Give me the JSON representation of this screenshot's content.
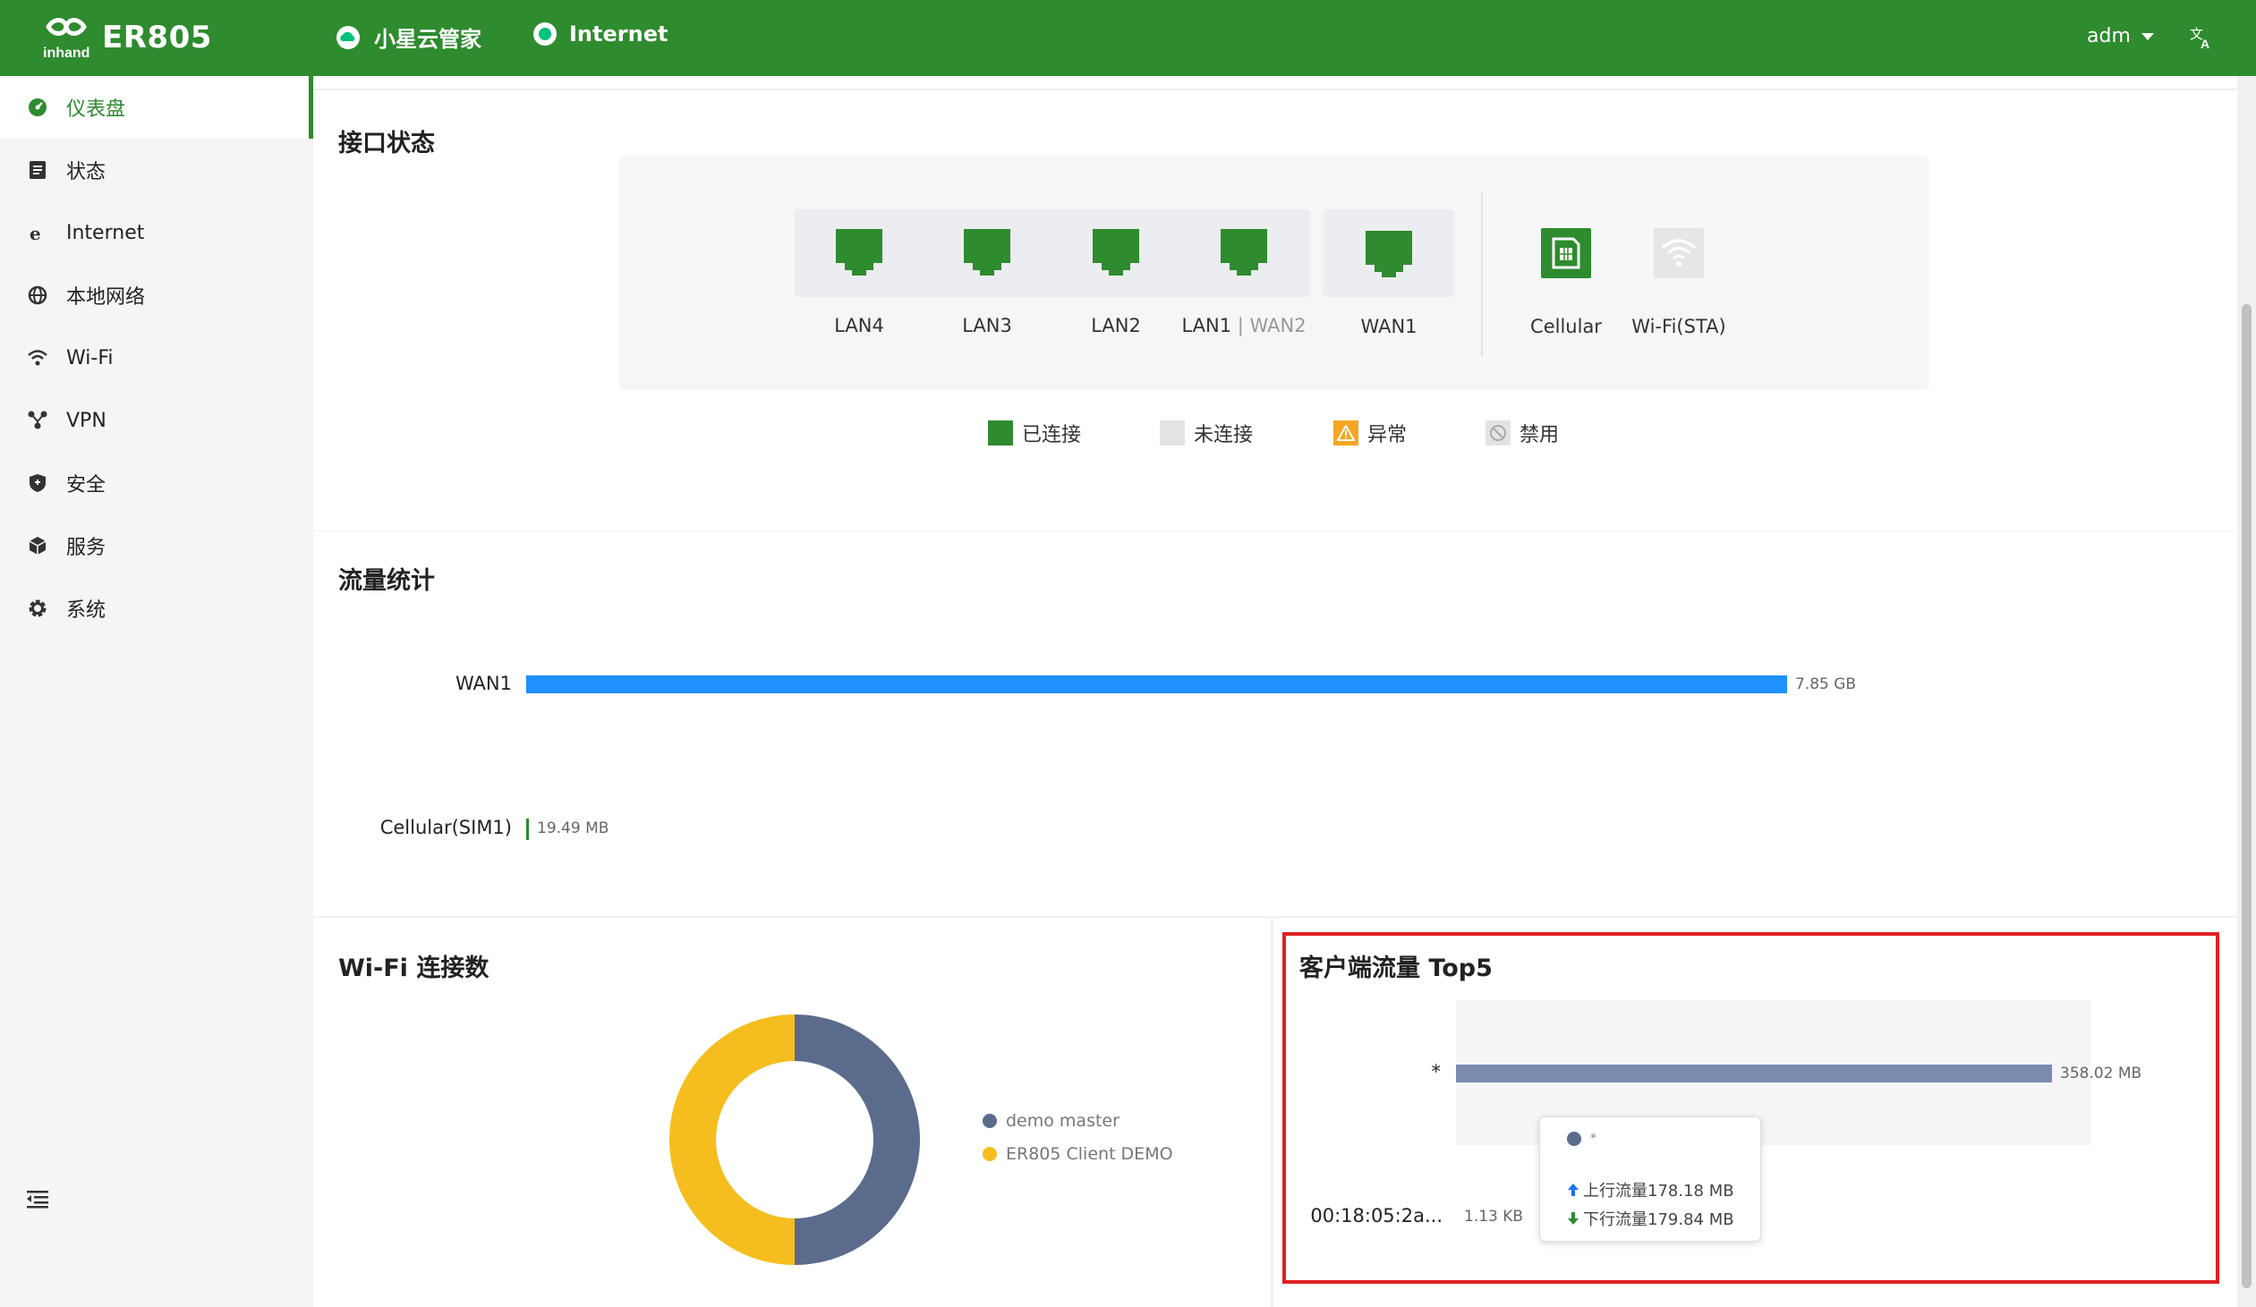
{
  "header": {
    "product": "ER805",
    "brand": "inhand",
    "cloud_label": "小星云管家",
    "internet_label": "Internet",
    "user": "adm"
  },
  "sidebar": {
    "items": [
      {
        "label": "仪表盘",
        "icon": "dashboard-icon"
      },
      {
        "label": "状态",
        "icon": "status-icon"
      },
      {
        "label": "Internet",
        "icon": "internet-icon"
      },
      {
        "label": "本地网络",
        "icon": "globe-icon"
      },
      {
        "label": "Wi-Fi",
        "icon": "wifi-icon"
      },
      {
        "label": "VPN",
        "icon": "vpn-icon"
      },
      {
        "label": "安全",
        "icon": "shield-icon"
      },
      {
        "label": "服务",
        "icon": "cube-icon"
      },
      {
        "label": "系统",
        "icon": "gear-icon"
      }
    ],
    "active": "仪表盘"
  },
  "interface_status": {
    "title": "接口状态",
    "ports": [
      {
        "label": "LAN4",
        "status": "connected"
      },
      {
        "label": "LAN3",
        "status": "connected"
      },
      {
        "label": "LAN2",
        "status": "connected"
      },
      {
        "label": "LAN1",
        "sub": "WAN2",
        "status": "connected"
      },
      {
        "label": "WAN1",
        "status": "connected"
      },
      {
        "label": "Cellular",
        "status": "connected"
      },
      {
        "label": "Wi-Fi(STA)",
        "status": "disconnected"
      }
    ],
    "legend": {
      "connected": "已连接",
      "disconnected": "未连接",
      "abnormal": "异常",
      "disabled": "禁用"
    }
  },
  "traffic": {
    "title": "流量统计",
    "rows": [
      {
        "label": "WAN1",
        "value": "7.85 GB"
      },
      {
        "label": "Cellular(SIM1)",
        "value": "19.49 MB"
      }
    ]
  },
  "wifi": {
    "title": "Wi-Fi 连接数",
    "legend": [
      {
        "name": "demo master",
        "color": "#5b6b8c"
      },
      {
        "name": "ER805 Client DEMO",
        "color": "#f5be1e"
      }
    ]
  },
  "top5": {
    "title": "客户端流量 Top5",
    "rows": [
      {
        "label": "*",
        "value": "358.02 MB"
      },
      {
        "label": "00:18:05:2a...",
        "value": "1.13 KB"
      }
    ],
    "tooltip": {
      "name": "*",
      "up": "上行流量178.18 MB",
      "down": "下行流量179.84 MB"
    }
  },
  "chart_data": [
    {
      "type": "bar",
      "categories": [
        "WAN1",
        "Cellular(SIM1)"
      ],
      "values": [
        7.85,
        0.01949
      ],
      "title": "流量统计"
    },
    {
      "type": "pie",
      "title": "Wi-Fi 连接数",
      "categories": [
        "demo master",
        "ER805 Client DEMO"
      ],
      "values": [
        1,
        1
      ]
    },
    {
      "type": "bar",
      "title": "客户端流量 Top5",
      "categories": [
        "*",
        "00:18:05:2a..."
      ],
      "values": [
        358.02,
        0.0011
      ]
    }
  ],
  "colors": {
    "brand_green": "#2e8b2e",
    "accent_blue": "#1e90ff",
    "pie_blue": "#5b6b8c",
    "pie_yellow": "#f5be1e",
    "top5_bar": "#7b8bb0",
    "highlight_red": "#e02020"
  }
}
